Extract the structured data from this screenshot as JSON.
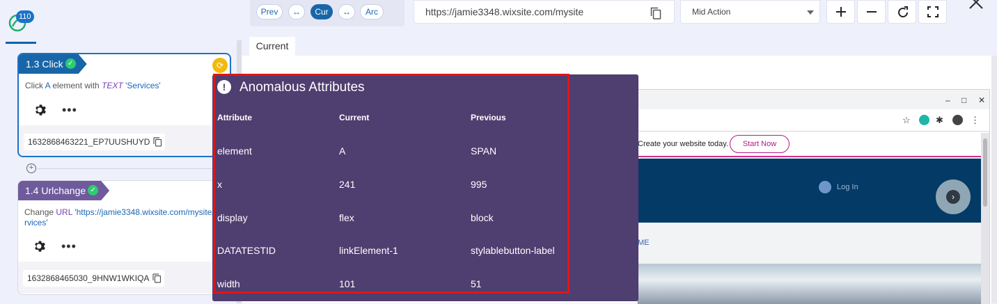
{
  "app": {
    "badge_count": "110"
  },
  "steps": [
    {
      "title": "1.3 Click",
      "desc_prefix": "Click",
      "desc_keyword": "A",
      "desc_middle": "element with",
      "desc_keyword2": "TEXT",
      "desc_value": "'Services'",
      "id": "1632868463221_EP7UUSHUYD"
    },
    {
      "title": "1.4 Urlchange",
      "desc_prefix": "Change",
      "desc_keyword": "URL",
      "desc_value": "'https://jamie3348.wixsite.com/mysite/services'",
      "id": "1632868465030_9HNW1WKIQA"
    }
  ],
  "toolbar": {
    "prev": "Prev",
    "cur": "Cur",
    "arc": "Arc",
    "url": "https://jamie3348.wixsite.com/mysite",
    "mode": "Mid Action"
  },
  "tabs": [
    "Current"
  ],
  "site": {
    "promo_text": "Create your website today.",
    "start_button": "Start Now",
    "login": "Log In",
    "me_text": "ME"
  },
  "anomaly": {
    "title": "Anomalous Attributes",
    "headers": [
      "Attribute",
      "Current",
      "Previous"
    ],
    "rows": [
      [
        "element",
        "A",
        "SPAN"
      ],
      [
        "x",
        "241",
        "995"
      ],
      [
        "display",
        "flex",
        "block"
      ],
      [
        "DATATESTID",
        "linkElement-1",
        "stylablebutton-label"
      ],
      [
        "width",
        "101",
        "51"
      ]
    ]
  },
  "colors": {
    "accent": "#1866a8",
    "panel": "#4f3e70",
    "highlight": "#e01616",
    "step2": "#6f5b9c"
  }
}
